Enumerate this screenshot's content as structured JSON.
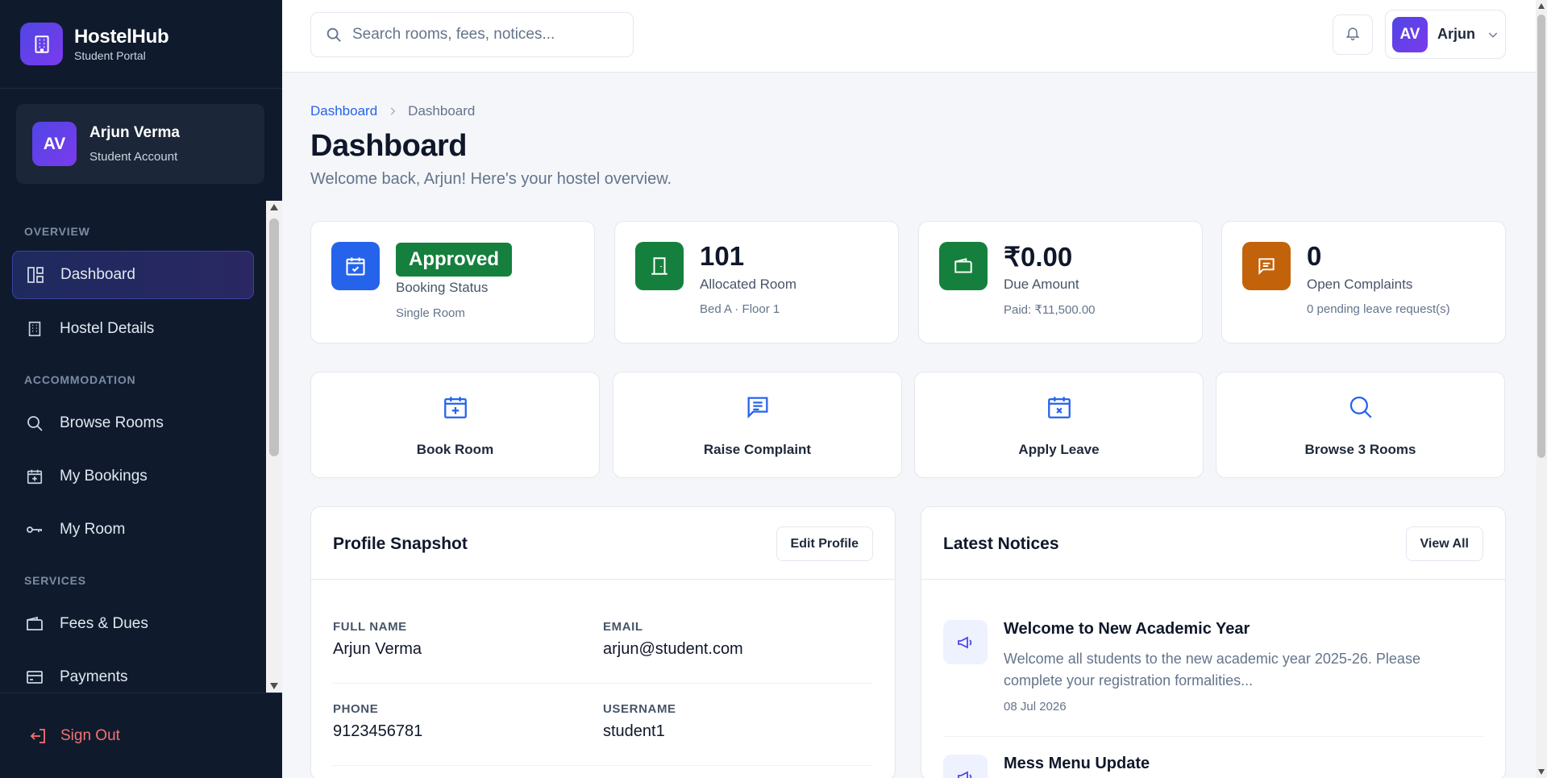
{
  "brand": {
    "name": "HostelHub",
    "subtitle": "Student Portal"
  },
  "user": {
    "initials": "AV",
    "name": "Arjun Verma",
    "role": "Student Account",
    "short_name": "Arjun"
  },
  "sidebar": {
    "sections": [
      "OVERVIEW",
      "ACCOMMODATION",
      "SERVICES"
    ],
    "items": [
      {
        "label": "Dashboard",
        "icon": "dashboard-icon",
        "active": true
      },
      {
        "label": "Hostel Details",
        "icon": "building-icon"
      },
      {
        "label": "Browse Rooms",
        "icon": "search-icon"
      },
      {
        "label": "My Bookings",
        "icon": "calendar-plus-icon"
      },
      {
        "label": "My Room",
        "icon": "key-icon"
      },
      {
        "label": "Fees & Dues",
        "icon": "wallet-icon"
      },
      {
        "label": "Payments",
        "icon": "credit-card-icon"
      }
    ],
    "sign_out": "Sign Out"
  },
  "search": {
    "placeholder": "Search rooms, fees, notices..."
  },
  "breadcrumb": {
    "root": "Dashboard",
    "current": "Dashboard"
  },
  "page": {
    "title": "Dashboard",
    "subtitle": "Welcome back, Arjun! Here's your hostel overview."
  },
  "stats": [
    {
      "value": "Approved",
      "label": "Booking Status",
      "sub": "Single Room",
      "color": "#2563eb",
      "icon": "calendar-check-icon"
    },
    {
      "value": "101",
      "label": "Allocated Room",
      "sub": "Bed A · Floor 1",
      "color": "#16a34a",
      "icon": "door-icon"
    },
    {
      "value": "₹0.00",
      "label": "Due Amount",
      "sub": "Paid: ₹11,500.00",
      "color": "#16a34a",
      "icon": "wallet-icon"
    },
    {
      "value": "0",
      "label": "Open Complaints",
      "sub": "0 pending leave request(s)",
      "color": "#d97706",
      "icon": "message-icon"
    }
  ],
  "actions": [
    {
      "label": "Book Room",
      "icon": "calendar-plus-icon"
    },
    {
      "label": "Raise Complaint",
      "icon": "message-icon"
    },
    {
      "label": "Apply Leave",
      "icon": "calendar-x-icon"
    },
    {
      "label": "Browse 3 Rooms",
      "icon": "search-icon"
    }
  ],
  "profile": {
    "title": "Profile Snapshot",
    "edit_label": "Edit Profile",
    "fields": [
      {
        "label": "FULL NAME",
        "value": "Arjun Verma"
      },
      {
        "label": "EMAIL",
        "value": "arjun@student.com"
      },
      {
        "label": "PHONE",
        "value": "9123456781"
      },
      {
        "label": "USERNAME",
        "value": "student1"
      }
    ]
  },
  "notices": {
    "title": "Latest Notices",
    "view_all": "View All",
    "items": [
      {
        "title": "Welcome to New Academic Year",
        "body": "Welcome all students to the new academic year 2025-26. Please complete your registration formalities...",
        "date": "08 Jul 2026"
      },
      {
        "title": "Mess Menu Update",
        "body": "",
        "date": ""
      }
    ]
  },
  "colors": {
    "accent": "#2563eb",
    "sidebar_bg": "#0f1b2d",
    "danger": "#f87171"
  }
}
